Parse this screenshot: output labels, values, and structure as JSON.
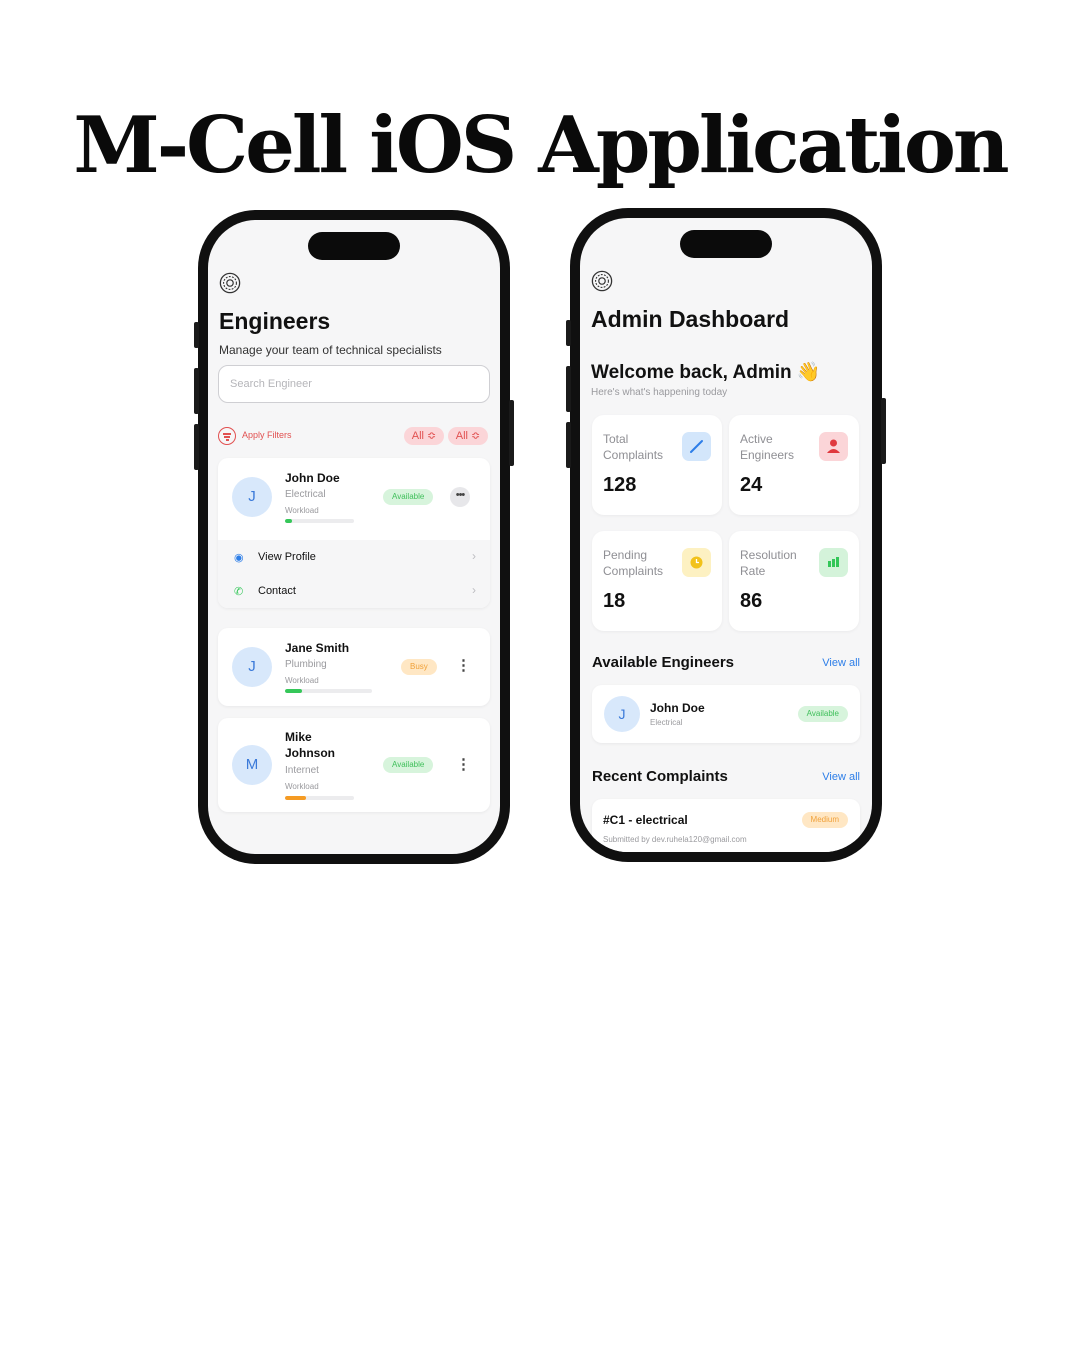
{
  "page": {
    "title": "M-Cell iOS Application"
  },
  "engineers_screen": {
    "title": "Engineers",
    "subtitle": "Manage your team of technical specialists",
    "search": {
      "placeholder": "Search Engineer",
      "icon": "search-input"
    },
    "filters": {
      "label": "Apply Filters",
      "icon": "filter-icon",
      "options": [
        {
          "label": "All ≎"
        },
        {
          "label": "All ≎"
        }
      ]
    },
    "engineers": [
      {
        "initial": "J",
        "name": "John Doe",
        "specialty": "Electrical",
        "workload_label": "Workload",
        "workload": 0.1,
        "workload_color": "#35c759",
        "status": "Available",
        "status_color": "green",
        "expanded": true
      },
      {
        "initial": "J",
        "name": "Jane Smith",
        "specialty": "Plumbing",
        "workload_label": "Workload",
        "workload": 0.2,
        "workload_color": "#35c759",
        "status": "Busy",
        "status_color": "orange"
      },
      {
        "initial": "M",
        "name_line1": "Mike",
        "name_line2": "Johnson",
        "specialty": "Internet",
        "workload_label": "Workload",
        "workload": 0.3,
        "workload_color": "#f59b23",
        "status": "Available",
        "status_color": "green"
      }
    ],
    "menu": {
      "view_profile": "View Profile",
      "contact": "Contact",
      "more_glyph": "•••",
      "kebab_glyph": "⋮",
      "chevron": "›"
    }
  },
  "admin_screen": {
    "title": "Admin Dashboard",
    "welcome": "Welcome back, Admin 👋",
    "welcome_sub": "Here's what's happening today",
    "stats": [
      {
        "label": "Total Complaints",
        "value": "128",
        "icon": "pencil-icon",
        "icon_bg": "#d3e6fb",
        "icon_color": "#2d7ee8"
      },
      {
        "label": "Active Engineers",
        "value": "24",
        "icon": "person-icon",
        "icon_bg": "#fbd5d8",
        "icon_color": "#e0393e"
      },
      {
        "label": "Pending Complaints",
        "value": "18",
        "icon": "clock-icon",
        "icon_bg": "#fdf1c2",
        "icon_color": "#f2c21a"
      },
      {
        "label": "Resolution Rate",
        "value": "86",
        "icon": "chart-icon",
        "icon_bg": "#d4f3da",
        "icon_color": "#34c759"
      }
    ],
    "available_engineers": {
      "title": "Available Engineers",
      "view_all": "View all",
      "items": [
        {
          "initial": "J",
          "name": "John Doe",
          "specialty": "Electrical",
          "status": "Available"
        }
      ]
    },
    "recent_complaints": {
      "title": "Recent Complaints",
      "view_all": "View all",
      "items": [
        {
          "id": "#C1 - electrical",
          "submitted_by": "Submitted by dev.ruhela120@gmail.com",
          "priority": "Medium"
        }
      ]
    }
  }
}
